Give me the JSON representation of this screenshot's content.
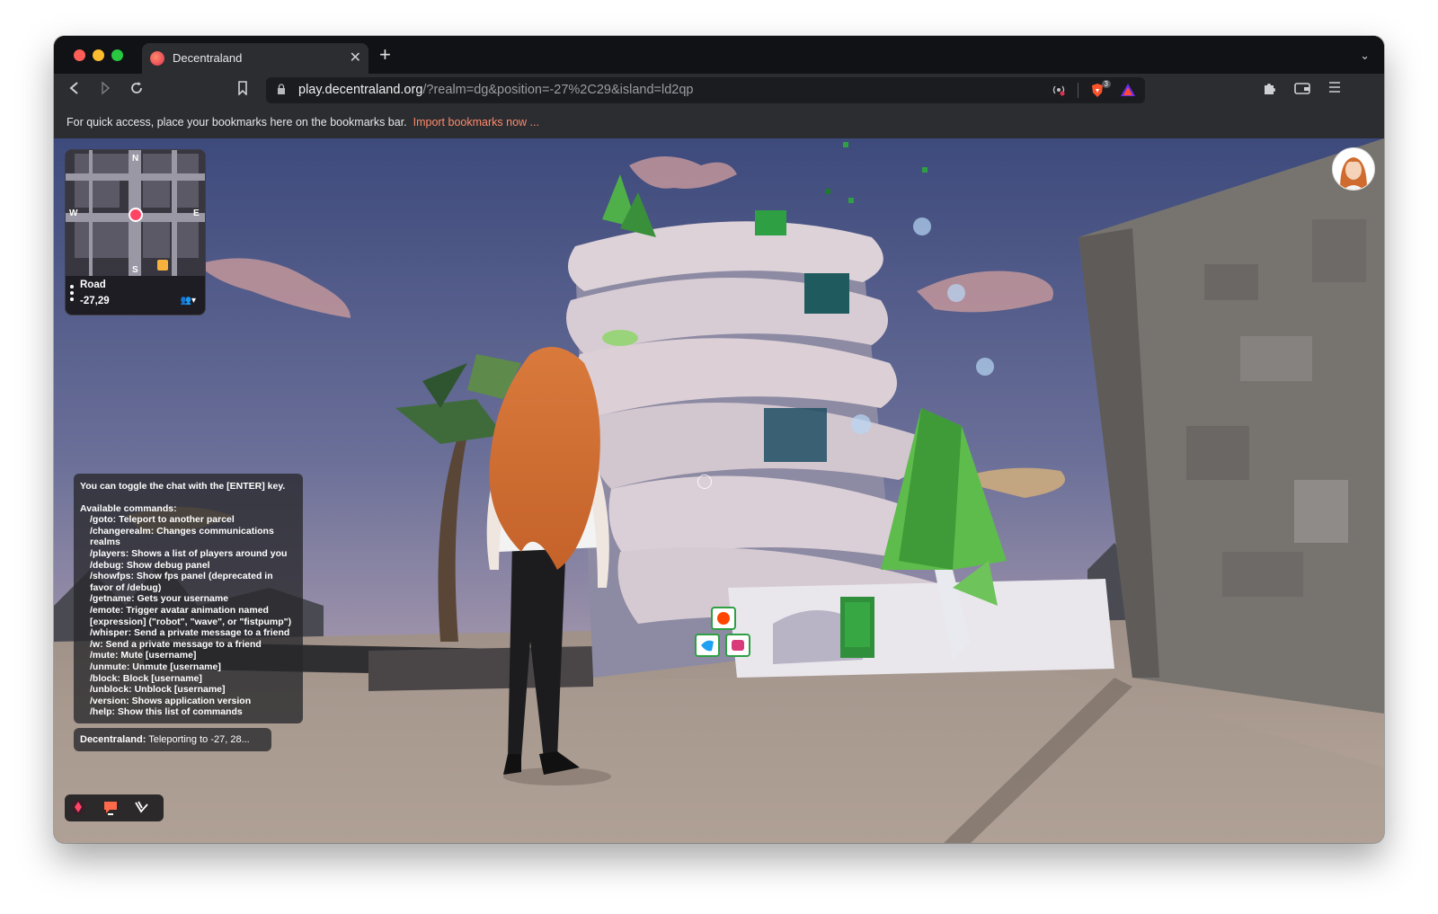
{
  "browser": {
    "tab_title": "Decentraland",
    "new_tab_symbol": "+",
    "url_host": "play.decentraland.org",
    "url_path": "/?realm=dg&position=-27%2C29&island=ld2qp",
    "brave_badge_count": "3",
    "bookmarks_prompt": "For quick access, place your bookmarks here on the bookmarks bar.",
    "bookmarks_link": "Import bookmarks now ..."
  },
  "minimap": {
    "north": "N",
    "south": "S",
    "west": "W",
    "east": "E",
    "place_name": "Road",
    "coordinates": "-27,29"
  },
  "chat": {
    "toggle_hint": "You can toggle the chat with the [ENTER] key.",
    "commands_heading": "Available commands:",
    "commands": [
      "/goto: Teleport to another parcel",
      "/changerealm: Changes communications realms",
      "/players: Shows a list of players around you",
      "/debug: Show debug panel",
      "/showfps: Show fps panel (deprecated in favor of /debug)",
      "/getname: Gets your username",
      "/emote: Trigger avatar animation named [expression] (\"robot\", \"wave\", or \"fistpump\")",
      "/whisper: Send a private message to a friend",
      "/w: Send a private message to a friend",
      "/mute: Mute [username]",
      "/unmute: Unmute [username]",
      "/block: Block [username]",
      "/unblock: Unblock [username]",
      "/version: Shows application version",
      "/help: Show this list of commands"
    ],
    "last_message_sender": "Decentraland:",
    "last_message_text": "Teleporting to -27, 28..."
  },
  "colors": {
    "accent_link": "#ff8a6b",
    "player_marker": "#ff4466",
    "sky_top": "#3f4a78",
    "sky_bottom": "#a89ab0",
    "ground": "#b3a59a"
  },
  "icons": {
    "back": "back-arrow-icon",
    "forward": "forward-arrow-icon",
    "reload": "reload-icon",
    "bookmark": "bookmark-icon",
    "lock": "lock-icon",
    "extensions": "puzzle-icon",
    "wallet": "wallet-icon",
    "menu": "hamburger-menu-icon"
  }
}
